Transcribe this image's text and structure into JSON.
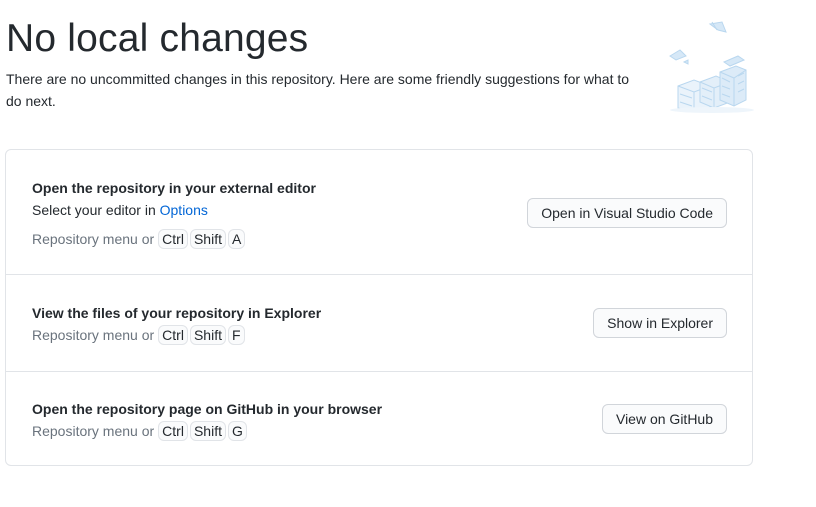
{
  "header": {
    "title": "No local changes",
    "subtitle": "There are no uncommitted changes in this repository. Here are some friendly suggestions for what to do next."
  },
  "illustration": {
    "icon": "empty-repository-illustration"
  },
  "suggestions": [
    {
      "title": "Open the repository in your external editor",
      "desc_prefix": "Select your editor in ",
      "desc_link": "Options",
      "shortcut_label": "Repository menu or",
      "keys": [
        "Ctrl",
        "Shift",
        "A"
      ],
      "button": "Open in Visual Studio Code"
    },
    {
      "title": "View the files of your repository in Explorer",
      "shortcut_label": "Repository menu or",
      "keys": [
        "Ctrl",
        "Shift",
        "F"
      ],
      "button": "Show in Explorer"
    },
    {
      "title": "Open the repository page on GitHub in your browser",
      "shortcut_label": "Repository menu or",
      "keys": [
        "Ctrl",
        "Shift",
        "G"
      ],
      "button": "View on GitHub"
    }
  ],
  "colors": {
    "link": "#0366d6",
    "border": "#e1e4e8",
    "muted": "#6a737d"
  }
}
